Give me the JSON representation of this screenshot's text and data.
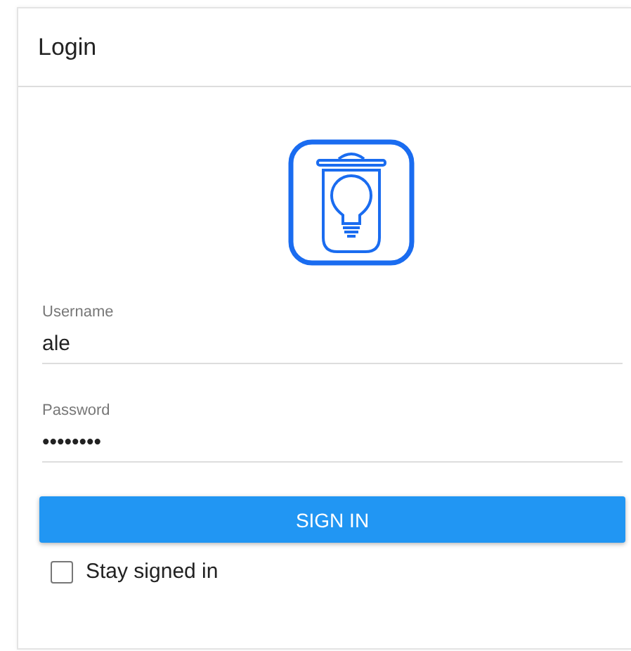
{
  "card": {
    "title": "Login"
  },
  "fields": [
    {
      "label": "Username",
      "value": "ale"
    },
    {
      "label": "Password",
      "value": "••••••••"
    }
  ],
  "sign_in_button": "SIGN IN",
  "stay_signed_in": {
    "label": "Stay signed in",
    "checked": false
  }
}
